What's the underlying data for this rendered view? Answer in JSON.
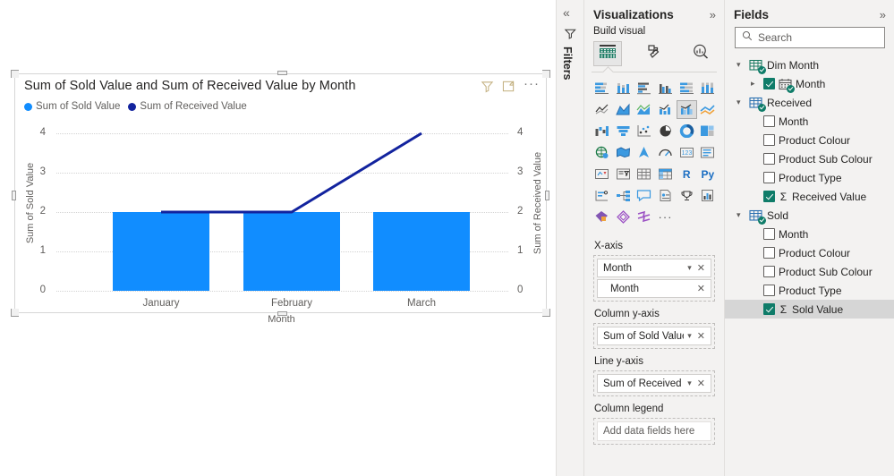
{
  "canvas": {
    "visual": {
      "title": "Sum of Sold Value and Sum of Received Value by Month",
      "header_icons": {
        "filter": "filter-icon",
        "focus": "focus-mode-icon",
        "more": "···"
      },
      "legend": [
        {
          "label": "Sum of Sold Value",
          "color": "#118DFF"
        },
        {
          "label": "Sum of Received Value",
          "color": "#12239E"
        }
      ]
    }
  },
  "chart_data": {
    "type": "bar",
    "title": "Sum of Sold Value and Sum of Received Value by Month",
    "categories": [
      "January",
      "February",
      "March"
    ],
    "series": [
      {
        "name": "Sum of Sold Value",
        "type": "column",
        "axis": "left",
        "values": [
          2,
          2,
          2
        ],
        "color": "#118DFF"
      },
      {
        "name": "Sum of Received Value",
        "type": "line",
        "axis": "right",
        "values": [
          2,
          2,
          4
        ],
        "color": "#12239E"
      }
    ],
    "xlabel": "Month",
    "ylabel": "Sum of Sold Value",
    "y2label": "Sum of Received Value",
    "ylim": [
      0,
      4
    ],
    "y2lim": [
      0,
      4
    ],
    "yticks": [
      "4",
      "3",
      "2",
      "1",
      "0"
    ],
    "y2ticks": [
      "4",
      "3",
      "2",
      "1",
      "0"
    ],
    "grid": true,
    "legend_position": "top-left"
  },
  "filters_pane": {
    "collapse_label": "«",
    "icon": "filter-icon",
    "title": "Filters"
  },
  "visualizations": {
    "title": "Visualizations",
    "expand": "»",
    "subtitle": "Build visual",
    "tabs": [
      {
        "name": "build-visual-tab",
        "icon": "fields-table-icon",
        "selected": true
      },
      {
        "name": "format-visual-tab",
        "icon": "paint-roller-icon",
        "selected": false
      },
      {
        "name": "analytics-tab",
        "icon": "magnifier-chart-icon",
        "selected": false
      }
    ],
    "gallery": [
      {
        "name": "stacked-bar-chart",
        "selected": false
      },
      {
        "name": "stacked-column-chart",
        "selected": false
      },
      {
        "name": "clustered-bar-chart",
        "selected": false
      },
      {
        "name": "clustered-column-chart",
        "selected": false
      },
      {
        "name": "100-percent-stacked-bar-chart",
        "selected": false
      },
      {
        "name": "100-percent-stacked-column-chart",
        "selected": false
      },
      {
        "name": "line-chart",
        "selected": false
      },
      {
        "name": "area-chart",
        "selected": false
      },
      {
        "name": "stacked-area-chart",
        "selected": false
      },
      {
        "name": "line-and-stacked-column-chart",
        "selected": false
      },
      {
        "name": "line-and-clustered-column-chart",
        "selected": true
      },
      {
        "name": "ribbon-chart",
        "selected": false
      },
      {
        "name": "waterfall-chart",
        "selected": false
      },
      {
        "name": "funnel-chart",
        "selected": false
      },
      {
        "name": "scatter-chart",
        "selected": false
      },
      {
        "name": "pie-chart",
        "selected": false
      },
      {
        "name": "donut-chart",
        "selected": false
      },
      {
        "name": "treemap-chart",
        "selected": false
      },
      {
        "name": "map-chart",
        "selected": false
      },
      {
        "name": "filled-map-chart",
        "selected": false
      },
      {
        "name": "azure-map-chart",
        "selected": false
      },
      {
        "name": "gauge-chart",
        "selected": false
      },
      {
        "name": "card-visual",
        "selected": false
      },
      {
        "name": "multi-row-card-visual",
        "selected": false
      },
      {
        "name": "kpi-visual",
        "selected": false
      },
      {
        "name": "slicer-visual",
        "selected": false
      },
      {
        "name": "table-visual",
        "selected": false
      },
      {
        "name": "matrix-visual",
        "selected": false
      },
      {
        "name": "r-script-visual",
        "selected": false,
        "text": "R"
      },
      {
        "name": "python-script-visual",
        "selected": false,
        "text": "Py"
      },
      {
        "name": "key-influencers-visual",
        "selected": false
      },
      {
        "name": "decomposition-tree-visual",
        "selected": false
      },
      {
        "name": "qna-visual",
        "selected": false
      },
      {
        "name": "smart-narrative-visual",
        "selected": false
      },
      {
        "name": "metrics-visual",
        "selected": false
      },
      {
        "name": "paginated-report-visual",
        "selected": false
      },
      {
        "name": "power-apps-visual",
        "selected": false
      },
      {
        "name": "power-automate-visual",
        "selected": false
      },
      {
        "name": "arcgis-maps-visual",
        "selected": false
      },
      {
        "name": "more-visuals",
        "selected": false,
        "text": "···"
      }
    ],
    "wells": [
      {
        "label": "X-axis",
        "chips": [
          {
            "name": "Month",
            "has_chevron": true,
            "has_remove": true,
            "nested": false
          },
          {
            "name": "Month",
            "has_chevron": false,
            "has_remove": true,
            "nested": true
          }
        ]
      },
      {
        "label": "Column y-axis",
        "chips": [
          {
            "name": "Sum of Sold Value",
            "has_chevron": true,
            "has_remove": true,
            "nested": false
          }
        ]
      },
      {
        "label": "Line y-axis",
        "chips": [
          {
            "name": "Sum of Received Value",
            "has_chevron": true,
            "has_remove": true,
            "nested": false
          }
        ]
      },
      {
        "label": "Column legend",
        "empty_text": "Add data fields here",
        "chips": []
      }
    ]
  },
  "fields": {
    "title": "Fields",
    "expand": "»",
    "search_placeholder": "Search",
    "tree": [
      {
        "name": "Dim Month",
        "type": "table",
        "expanded": true,
        "fields": [
          {
            "name": "Month",
            "checked": true,
            "kind": "date-hierarchy",
            "expandable": true,
            "selected": false
          }
        ]
      },
      {
        "name": "Received",
        "type": "table",
        "expanded": true,
        "fields": [
          {
            "name": "Month",
            "checked": false,
            "kind": "column",
            "selected": false
          },
          {
            "name": "Product Colour",
            "checked": false,
            "kind": "column",
            "selected": false
          },
          {
            "name": "Product Sub Colour",
            "checked": false,
            "kind": "column",
            "selected": false
          },
          {
            "name": "Product Type",
            "checked": false,
            "kind": "column",
            "selected": false
          },
          {
            "name": "Received Value",
            "checked": true,
            "kind": "measure",
            "selected": false
          }
        ]
      },
      {
        "name": "Sold",
        "type": "table",
        "expanded": true,
        "fields": [
          {
            "name": "Month",
            "checked": false,
            "kind": "column",
            "selected": false
          },
          {
            "name": "Product Colour",
            "checked": false,
            "kind": "column",
            "selected": false
          },
          {
            "name": "Product Sub Colour",
            "checked": false,
            "kind": "column",
            "selected": false
          },
          {
            "name": "Product Type",
            "checked": false,
            "kind": "column",
            "selected": false
          },
          {
            "name": "Sold Value",
            "checked": true,
            "kind": "measure",
            "selected": true
          }
        ]
      }
    ]
  },
  "colors": {
    "column": "#118DFF",
    "line": "#12239E",
    "pane_bg": "#f3f2f1",
    "check_green": "#0f7c69"
  }
}
